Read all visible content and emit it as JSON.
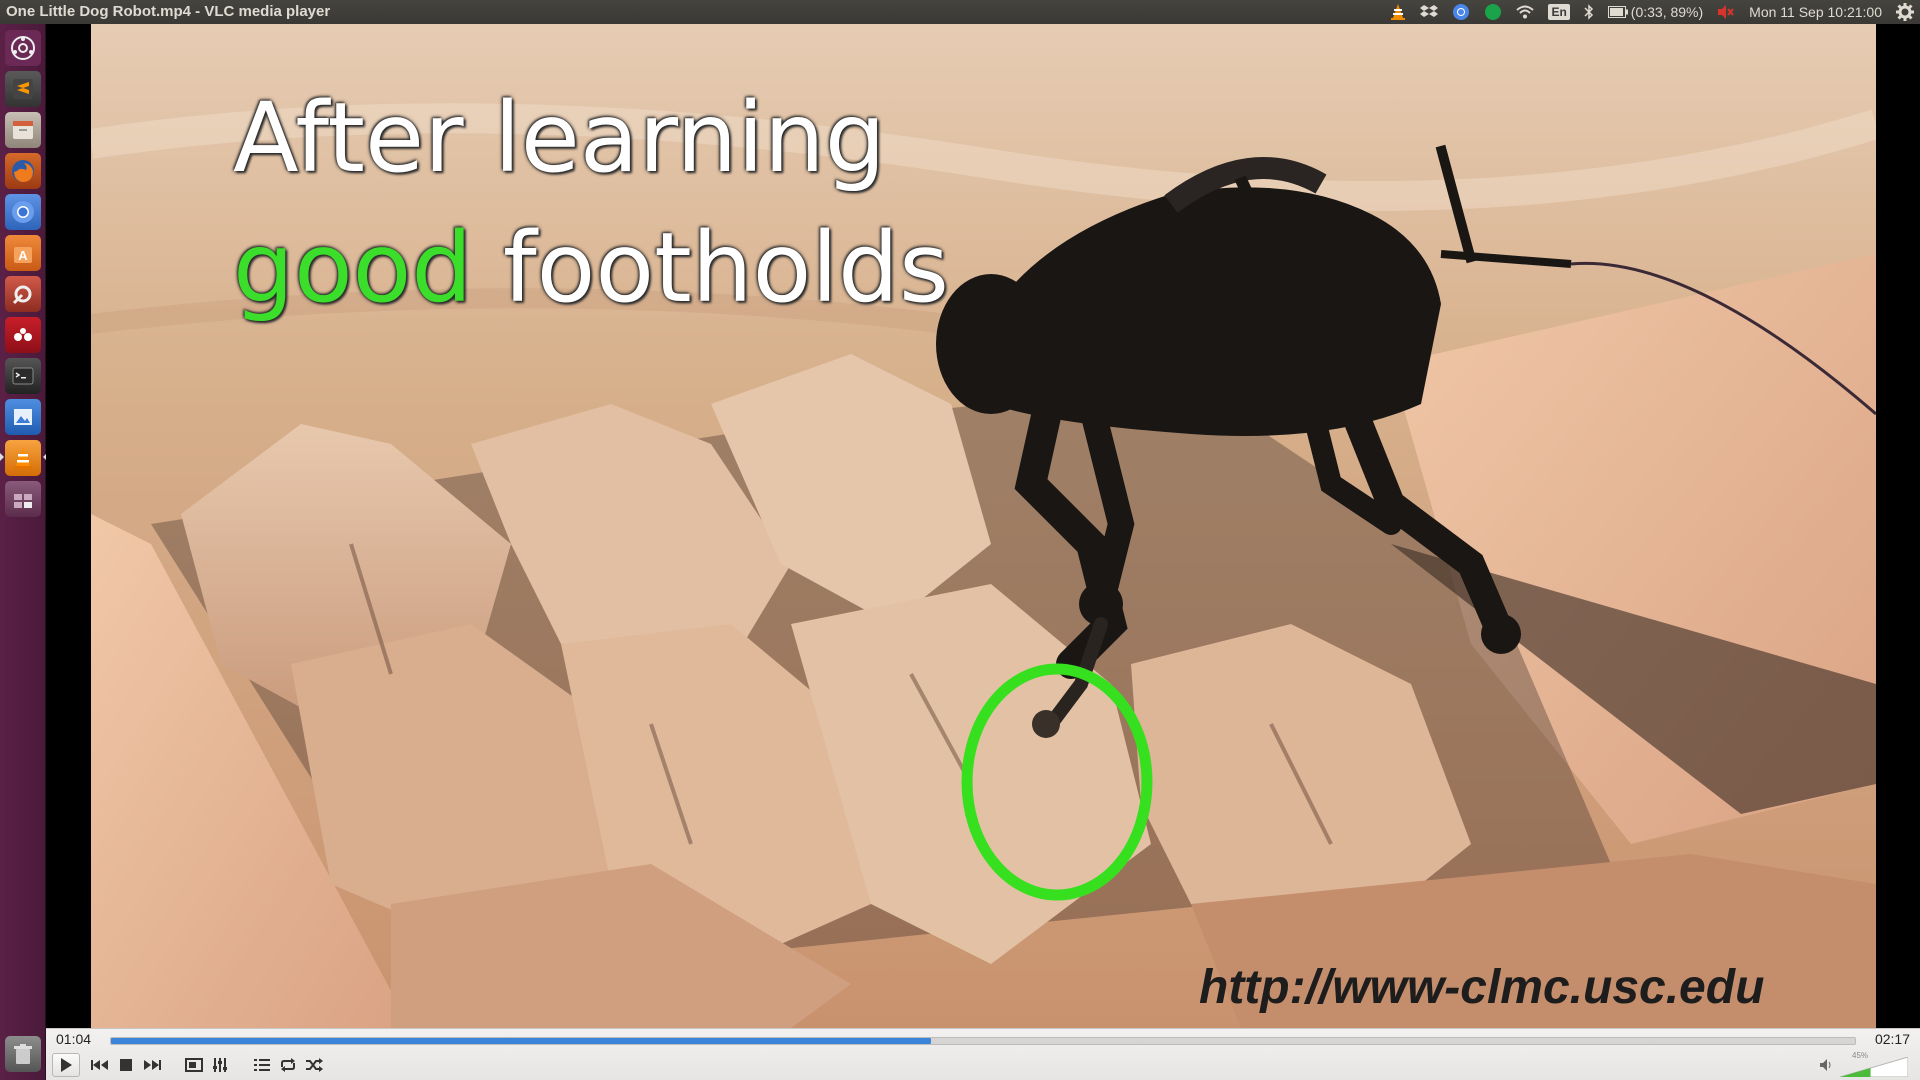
{
  "window": {
    "title": "One Little Dog Robot.mp4 - VLC media player"
  },
  "panel": {
    "indicators": [
      {
        "icon": "vlc-cone-icon"
      },
      {
        "icon": "dropbox-icon"
      },
      {
        "icon": "chromium-icon"
      },
      {
        "icon": "status-dot-icon"
      },
      {
        "icon": "wifi-icon"
      },
      {
        "icon": "keyboard-layout-icon",
        "label": "En"
      },
      {
        "icon": "bluetooth-icon"
      },
      {
        "icon": "battery-icon",
        "label": "(0:33, 89%)"
      },
      {
        "icon": "volume-muted-icon"
      },
      {
        "icon": "clock",
        "label": "Mon 11 Sep 10:21:00"
      },
      {
        "icon": "gear-icon"
      }
    ]
  },
  "launcher": {
    "items": [
      {
        "name": "dash-home-icon",
        "color": "#6b2a55"
      },
      {
        "name": "sublime-text-icon",
        "color": "#e27a1d"
      },
      {
        "name": "file-manager-icon",
        "color": "#c9a063"
      },
      {
        "name": "firefox-icon",
        "color": "#e66000"
      },
      {
        "name": "chromium-icon",
        "color": "#4a86e8"
      },
      {
        "name": "software-center-icon",
        "color": "#e8752d"
      },
      {
        "name": "system-settings-icon",
        "color": "#c44"
      },
      {
        "name": "mendeley-icon",
        "color": "#d42020"
      },
      {
        "name": "terminal-icon",
        "color": "#333"
      },
      {
        "name": "image-viewer-icon",
        "color": "#3b7dd8"
      },
      {
        "name": "vlc-icon",
        "color": "#f08000"
      },
      {
        "name": "workspace-switcher-icon",
        "color": "#7a4a6a"
      },
      {
        "name": "trash-icon",
        "color": "#777"
      }
    ]
  },
  "video": {
    "caption_line1": "After learning",
    "caption_line2_green": "good",
    "caption_line2_white": " footholds",
    "url_text": "http://www-clmc.usc.edu"
  },
  "player": {
    "time_elapsed": "01:04",
    "time_total": "02:17",
    "progress": 0.47,
    "volume_label": "45%",
    "volume": 0.45,
    "accent_color": "#3a85d9"
  }
}
